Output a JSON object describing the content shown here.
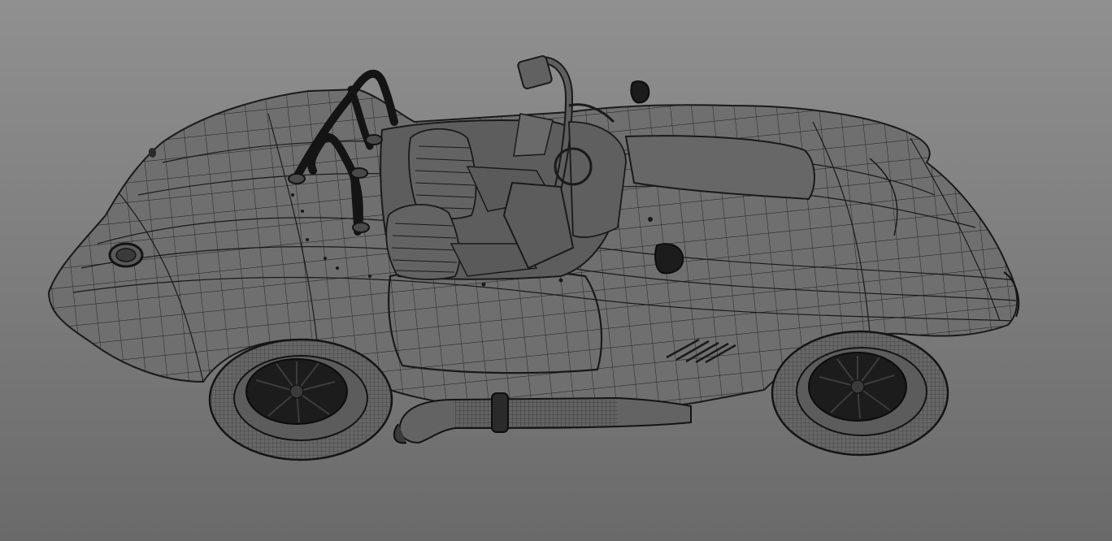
{
  "viewport": {
    "background_top": "#909090",
    "background_bottom": "#6a6a6a"
  },
  "model": {
    "shading": "wireframe-on-shaded",
    "surface_color": "#6f6f6f",
    "wire_color": "#1e1e1e",
    "dark_part_color": "#1a1a1a"
  }
}
